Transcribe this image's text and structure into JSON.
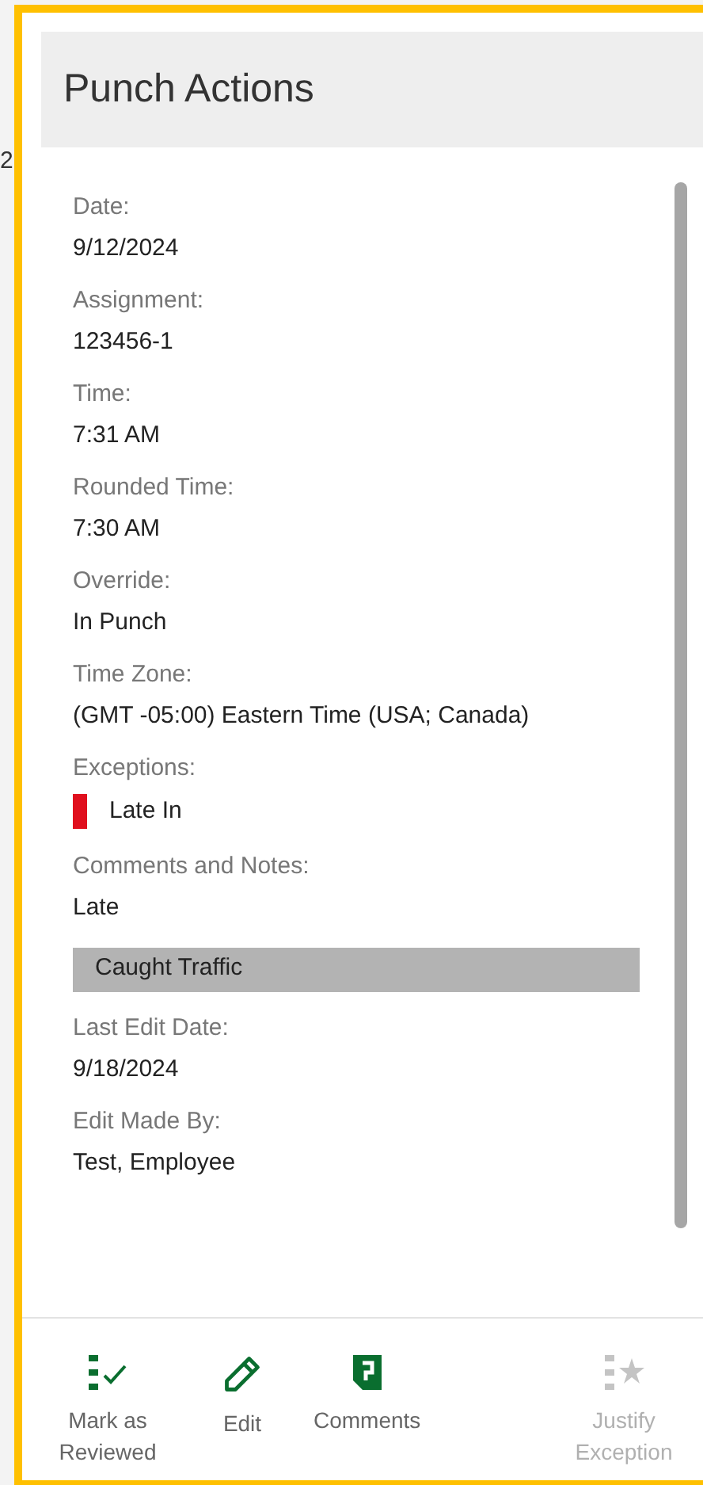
{
  "background": {
    "fragment": "2"
  },
  "panel": {
    "title": "Punch Actions",
    "fields": [
      {
        "kind": "text",
        "label": "Date:",
        "value": "9/12/2024"
      },
      {
        "kind": "text",
        "label": "Assignment:",
        "value": "123456-1"
      },
      {
        "kind": "text",
        "label": "Time:",
        "value": "7:31 AM"
      },
      {
        "kind": "text",
        "label": "Rounded Time:",
        "value": "7:30 AM"
      },
      {
        "kind": "text",
        "label": "Override:",
        "value": "In Punch"
      },
      {
        "kind": "text",
        "label": "Time Zone:",
        "value": "(GMT -05:00) Eastern Time (USA; Canada)"
      },
      {
        "kind": "exception",
        "label": "Exceptions:",
        "value": "Late In",
        "color": "#e0101e"
      },
      {
        "kind": "comments",
        "label": "Comments and Notes:",
        "value": "Late",
        "note": "Caught Traffic"
      },
      {
        "kind": "text",
        "label": "Last Edit Date:",
        "value": "9/18/2024"
      },
      {
        "kind": "text",
        "label": "Edit Made By:",
        "value": "Test, Employee"
      }
    ],
    "actions": [
      {
        "kind": "review",
        "label": "Mark as Reviewed",
        "disabled": false
      },
      {
        "kind": "edit",
        "label": "Edit",
        "disabled": false
      },
      {
        "kind": "comments",
        "label": "Comments",
        "disabled": false
      },
      {
        "kind": "justify",
        "label": "Justify Exception",
        "disabled": true
      }
    ]
  }
}
